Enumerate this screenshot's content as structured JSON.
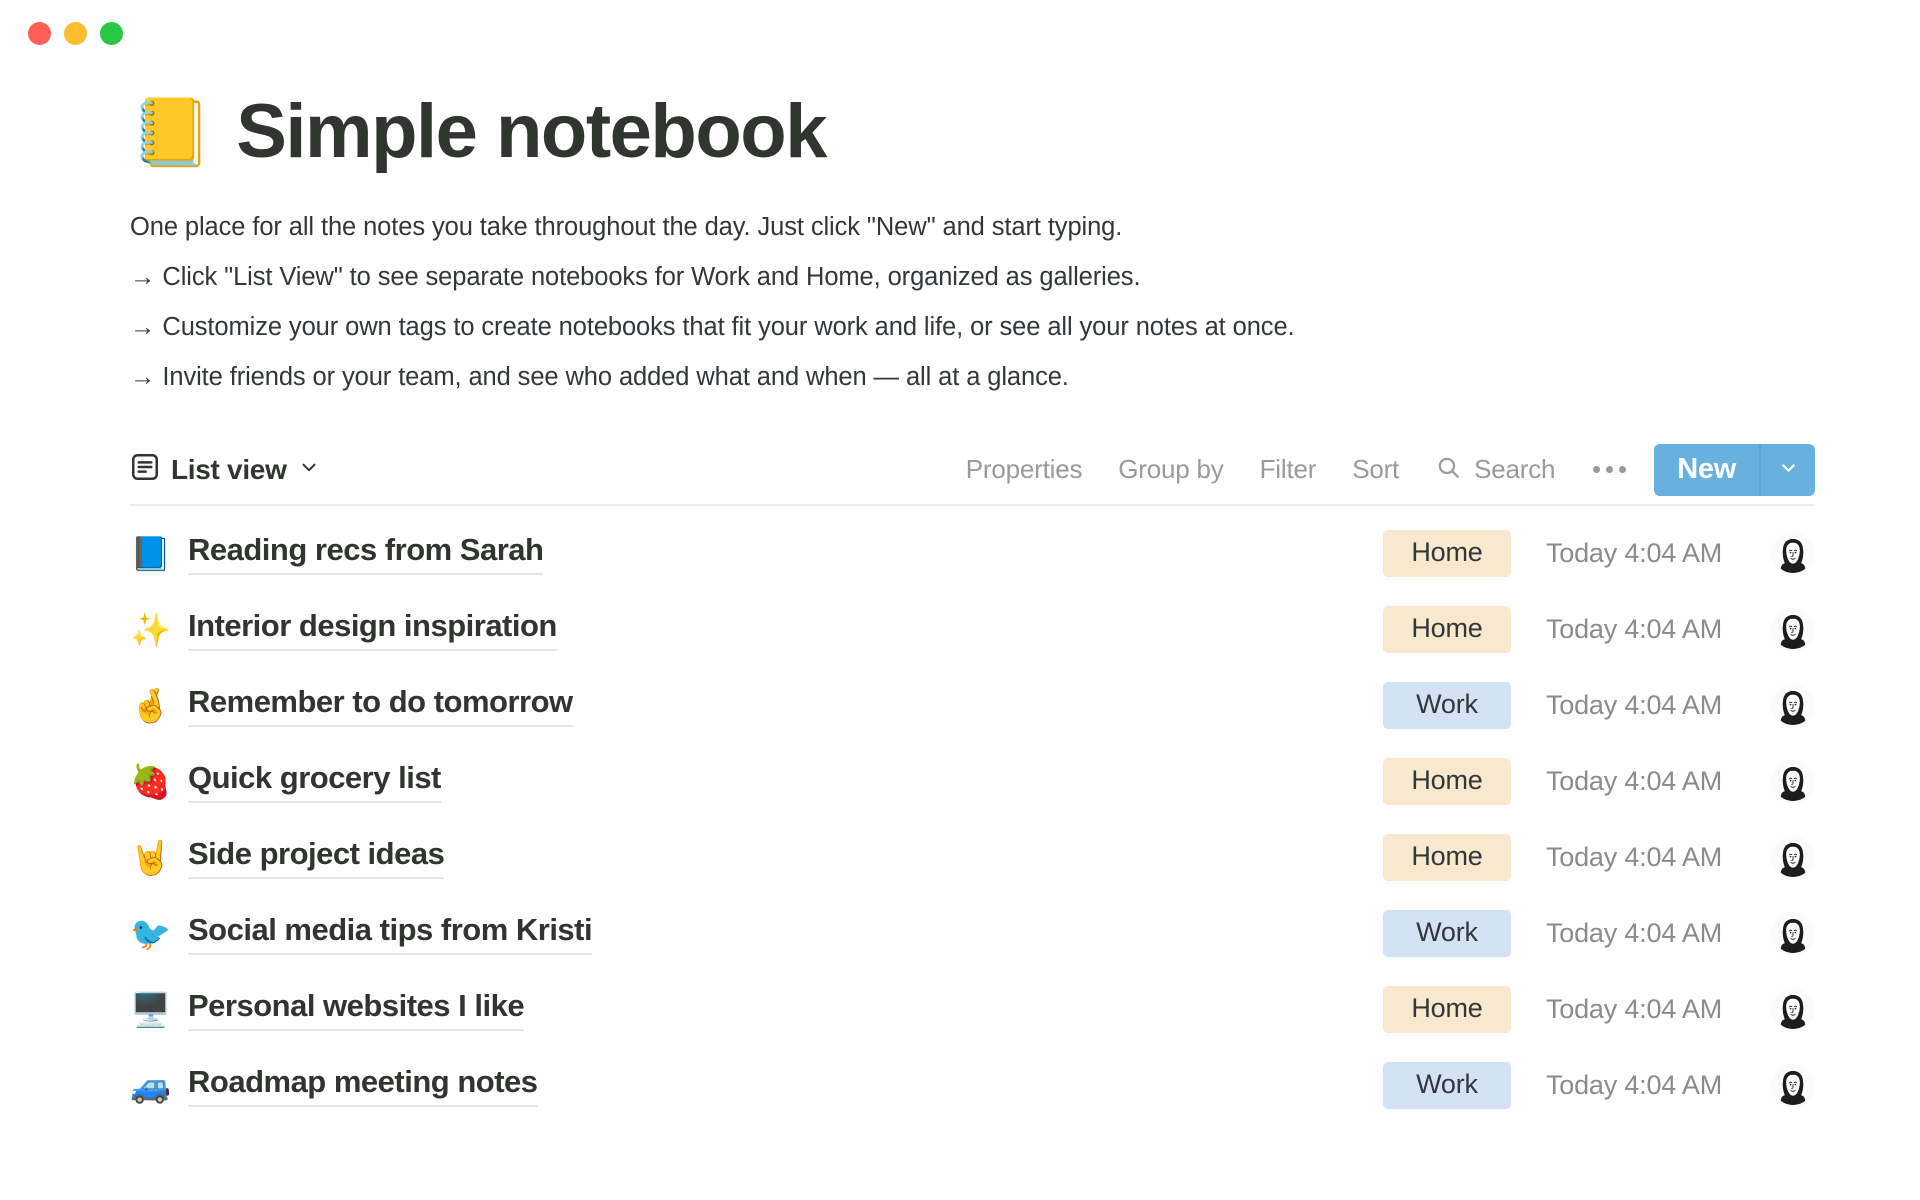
{
  "window": {
    "traffic_lights": [
      {
        "name": "close",
        "color": "#ff5f57"
      },
      {
        "name": "minimize",
        "color": "#febc2e"
      },
      {
        "name": "maximize",
        "color": "#28c840"
      }
    ]
  },
  "page": {
    "emoji": "📒",
    "emoji_name": "notebook-emoji",
    "title": "Simple notebook",
    "description_lines": [
      "One place for all the notes you take throughout the day. Just click \"New\" and start typing.",
      "→ Click \"List View\" to see separate notebooks for Work and Home, organized as galleries.",
      "→ Customize your own tags to create notebooks that fit your work and life, or see all your notes at once.",
      "→ Invite friends or your team, and see who added what and when — all at a glance."
    ]
  },
  "toolbar": {
    "view_label": "List view",
    "items": [
      {
        "label": "Properties",
        "name": "properties"
      },
      {
        "label": "Group by",
        "name": "group-by"
      },
      {
        "label": "Filter",
        "name": "filter"
      },
      {
        "label": "Sort",
        "name": "sort"
      }
    ],
    "search_label": "Search",
    "new_label": "New",
    "accent_color": "#68b1de"
  },
  "list": {
    "rows": [
      {
        "emoji": "📘",
        "emoji_name": "blue-book-emoji",
        "title": "Reading recs from Sarah",
        "tag": "Home",
        "tag_class": "tag-home",
        "time": "Today 4:04 AM"
      },
      {
        "emoji": "✨",
        "emoji_name": "sparkles-emoji",
        "title": "Interior design inspiration",
        "tag": "Home",
        "tag_class": "tag-home",
        "time": "Today 4:04 AM"
      },
      {
        "emoji": "🤞",
        "emoji_name": "crossed-fingers-emoji",
        "title": "Remember to do tomorrow",
        "tag": "Work",
        "tag_class": "tag-work",
        "time": "Today 4:04 AM"
      },
      {
        "emoji": "🍓",
        "emoji_name": "strawberry-emoji",
        "title": "Quick grocery list",
        "tag": "Home",
        "tag_class": "tag-home",
        "time": "Today 4:04 AM"
      },
      {
        "emoji": "🤘",
        "emoji_name": "rock-on-emoji",
        "title": "Side project ideas",
        "tag": "Home",
        "tag_class": "tag-home",
        "time": "Today 4:04 AM"
      },
      {
        "emoji": "🐦",
        "emoji_name": "bird-emoji",
        "title": "Social media tips from Kristi",
        "tag": "Work",
        "tag_class": "tag-work",
        "time": "Today 4:04 AM"
      },
      {
        "emoji": "🖥️",
        "emoji_name": "desktop-computer-emoji",
        "title": "Personal websites I like",
        "tag": "Home",
        "tag_class": "tag-home",
        "time": "Today 4:04 AM"
      },
      {
        "emoji": "🚙",
        "emoji_name": "car-emoji",
        "title": "Roadmap meeting notes",
        "tag": "Work",
        "tag_class": "tag-work",
        "time": "Today 4:04 AM"
      }
    ]
  }
}
